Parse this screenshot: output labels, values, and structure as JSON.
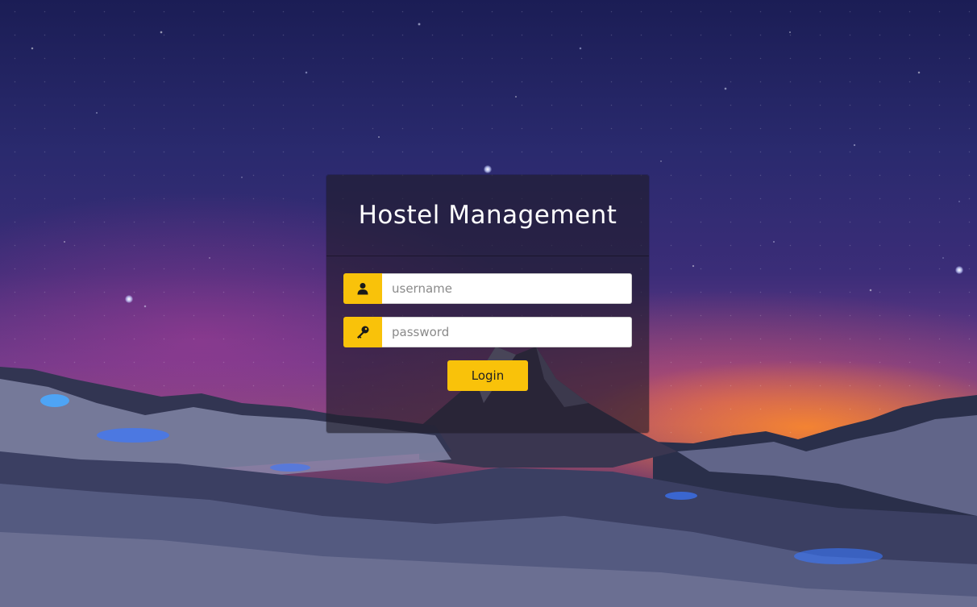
{
  "app": {
    "title": "Hostel Management"
  },
  "login_form": {
    "username": {
      "placeholder": "username",
      "value": "",
      "icon": "user-icon"
    },
    "password": {
      "placeholder": "password",
      "value": "",
      "icon": "key-icon"
    },
    "submit_label": "Login"
  },
  "colors": {
    "accent": "#f9c20a",
    "panel": "rgba(30,28,40,0.62)",
    "title_text": "#ffffff"
  }
}
